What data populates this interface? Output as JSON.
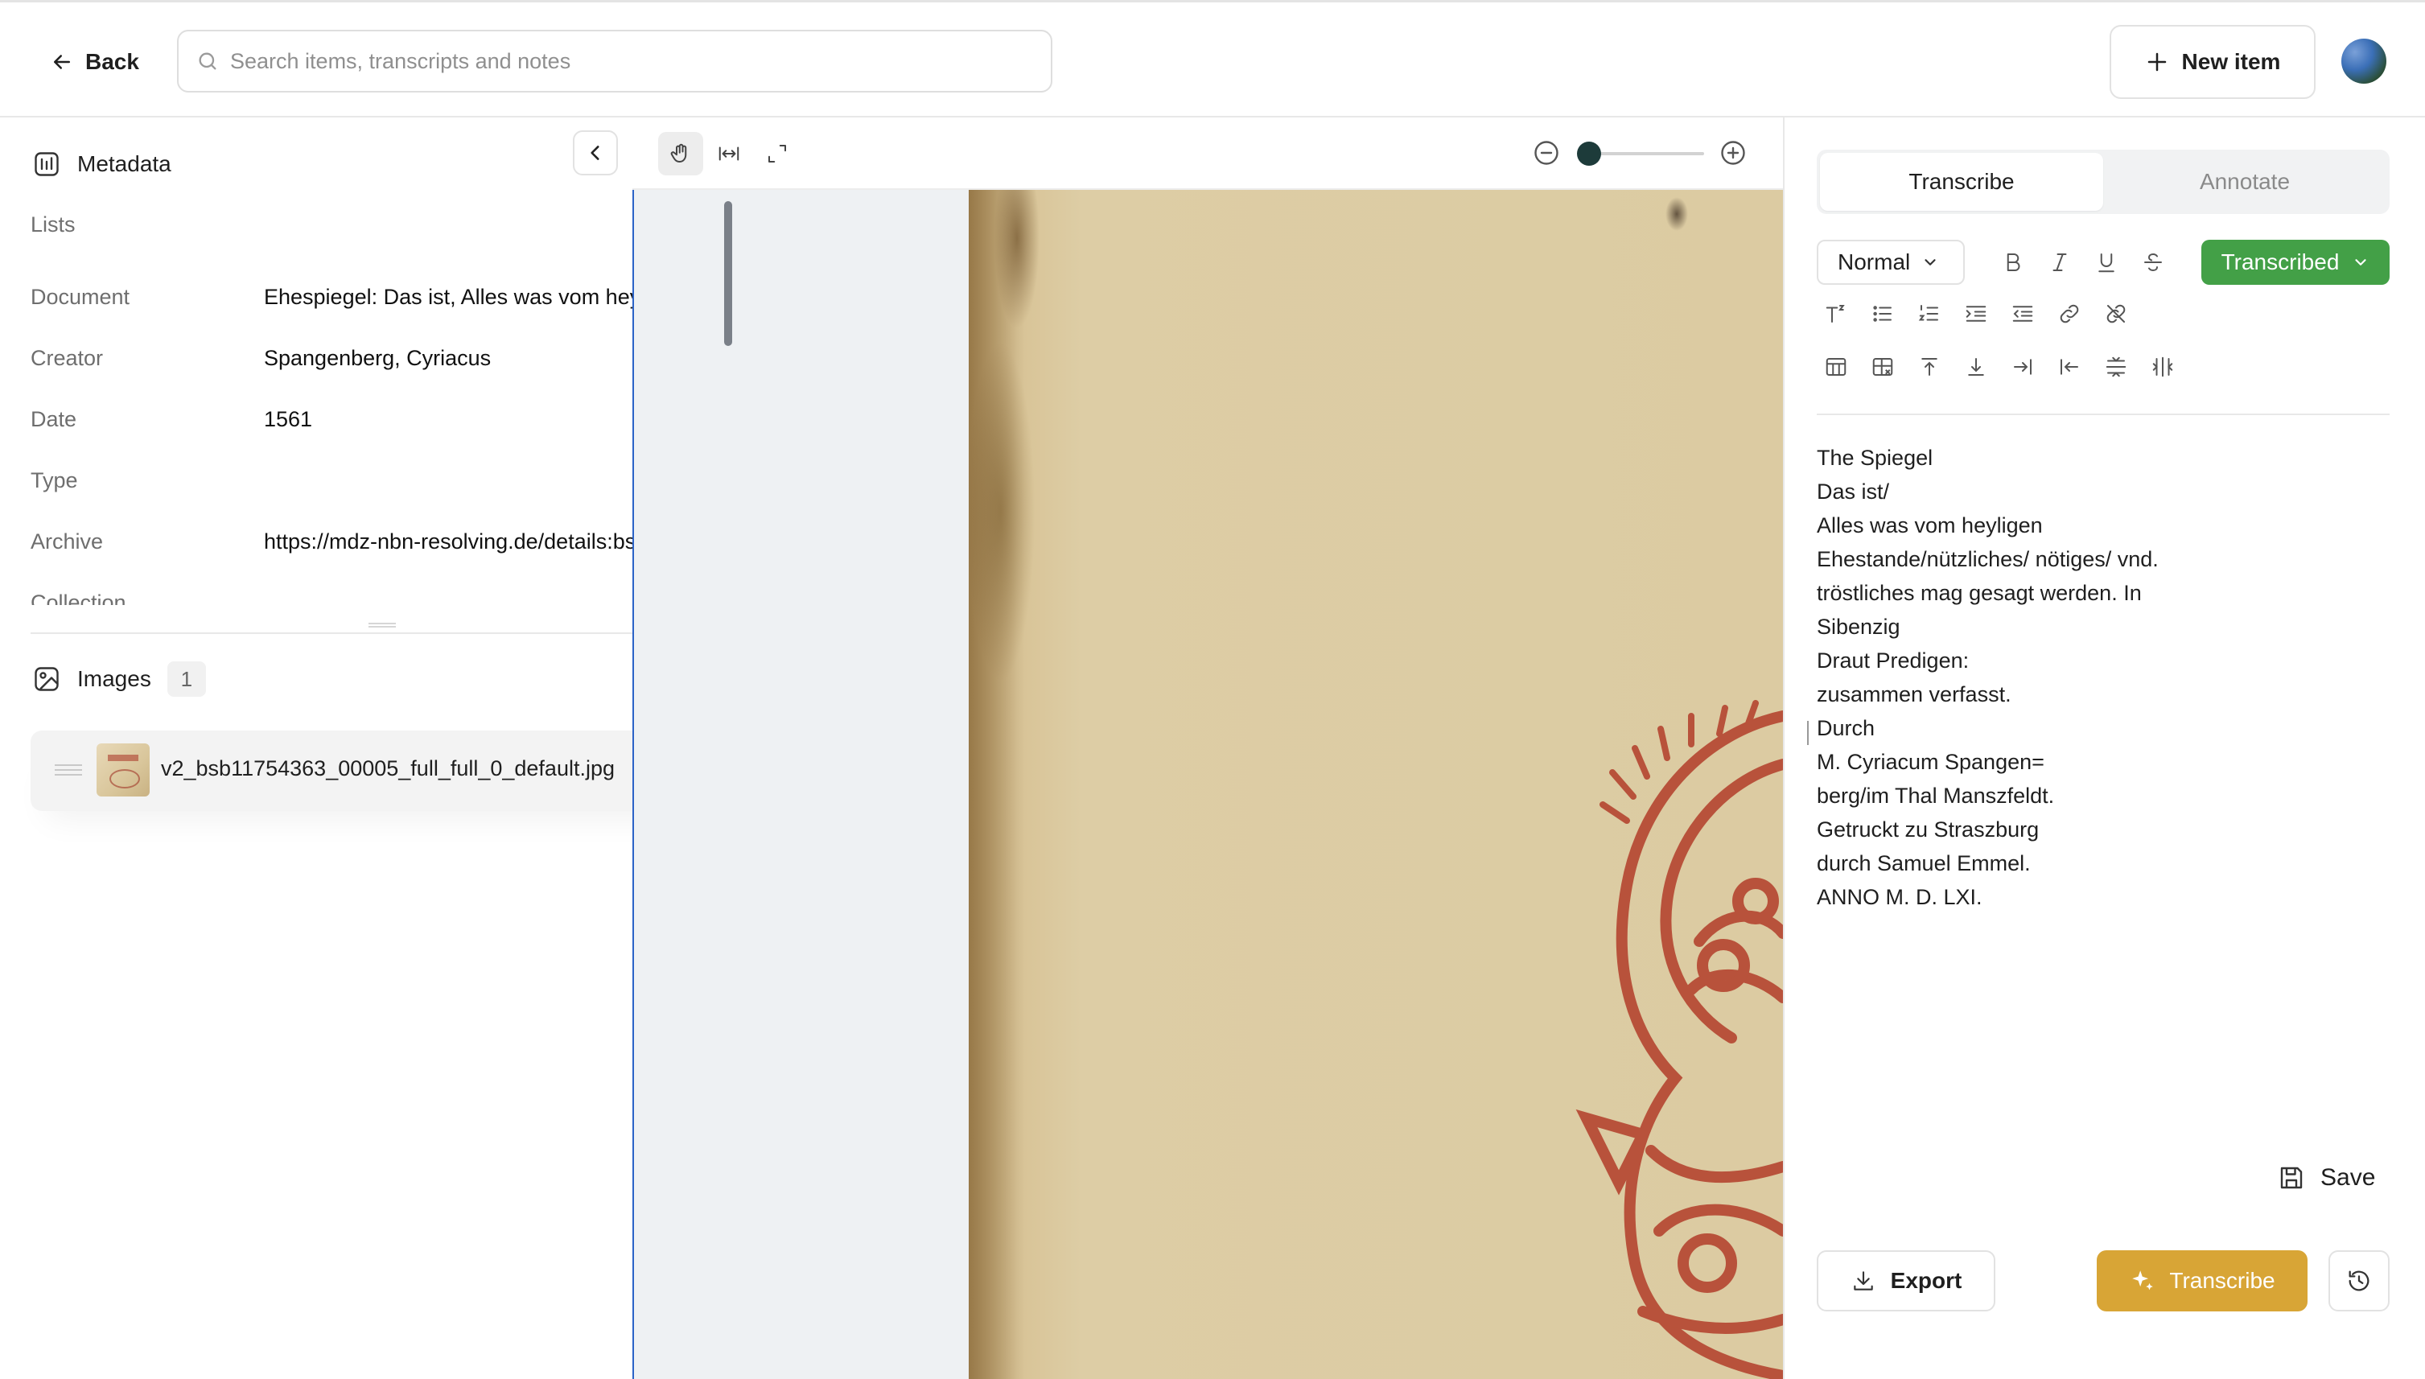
{
  "header": {
    "back_label": "Back",
    "search_placeholder": "Search items, transcripts and notes",
    "new_item_label": "New item"
  },
  "metadata": {
    "title": "Metadata",
    "lists_label": "Lists",
    "fields": [
      {
        "key": "Document",
        "value": "Ehespiegel: Das ist, Alles was vom heylige..."
      },
      {
        "key": "Creator",
        "value": "Spangenberg, Cyriacus"
      },
      {
        "key": "Date",
        "value": "1561"
      },
      {
        "key": "Type",
        "value": ""
      },
      {
        "key": "Archive",
        "value": "https://mdz-nbn-resolving.de/details:bsb..."
      },
      {
        "key": "Collection",
        "value": ""
      }
    ]
  },
  "images": {
    "title": "Images",
    "count": "1",
    "items": [
      {
        "filename": "v2_bsb11754363_00005_full_full_0_default.jpg",
        "status_color": "#3ba84a"
      }
    ]
  },
  "viewer": {
    "tools": [
      "hand-icon",
      "fit-width-icon",
      "fullscreen-icon"
    ],
    "zoom_level": 0.1
  },
  "transcript": {
    "tabs": [
      {
        "label": "Transcribe",
        "active": true
      },
      {
        "label": "Annotate",
        "active": false
      }
    ],
    "text_style": "Normal",
    "status": "Transcribed",
    "status_color": "#43a047",
    "lines": [
      "The Spiegel",
      "Das ist/",
      "Alles was vom heyligen",
      "Ehestande/nützliches/ nötiges/ vnd.",
      "tröstliches mag gesagt werden. In",
      "Sibenzig",
      "Draut Predigen:",
      "zusammen verfasst.",
      "Durch",
      "M. Cyriacum Spangen=",
      "berg/im Thal Manszfeldt.",
      "Getruckt zu Straszburg",
      "durch Samuel Emmel.",
      "ANNO M. D. LXI."
    ],
    "save_label": "Save",
    "export_label": "Export",
    "transcribe_label": "Transcribe",
    "transcribe_color": "#d8a536"
  }
}
